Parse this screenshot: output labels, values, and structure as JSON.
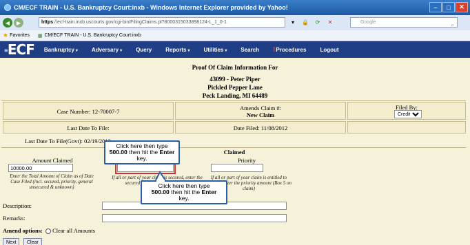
{
  "window": {
    "title": "CM/ECF TRAIN - U.S. Bankruptcy Court:inxb - Windows Internet Explorer provided by Yahoo!",
    "buttons": [
      "–",
      "□",
      "✕"
    ]
  },
  "browser": {
    "url_bold_prefix": "https",
    "url": "://ecf-train.inxb.uscourts.gov/cgi-bin/FilingClaims.pl?8000315033898124-L_1_0-1",
    "search_placeholder": "Google",
    "favorites_label": "Favorites",
    "tab_label": "CM/ECF TRAIN - U.S. Bankruptcy Court:inxb"
  },
  "ecf_menu": {
    "logo": "ECF",
    "items": [
      "Bankruptcy",
      "Adversary",
      "Query",
      "Reports",
      "Utilities",
      "Search",
      "Procedures",
      "Logout"
    ]
  },
  "header": {
    "title": "Proof Of Claim Information For",
    "case_line": "43099 - Peter Piper",
    "address1": "Pickled Pepper Lane",
    "address2": "Peck Landing, MI 64489"
  },
  "fields": {
    "case_number_label": "Case Number: 12-70007-7",
    "amends_label": "Amends Claim #:",
    "amends_value": "New Claim",
    "filed_by_label": "Filed By:",
    "filed_by_value": "Creditor",
    "last_date_label": "Last Date To File:",
    "date_filed_label": "Date Filed: 11/08/2012",
    "last_date_govt_label": "Last Date To File(Govt): 02/19/2013"
  },
  "amounts": {
    "claimed_header": "Claimed",
    "amount_claimed_label": "Amount Claimed",
    "amount_claimed_value": "10000.00",
    "amount_claimed_help": "Enter the Total Amount of Claim as of Date Case Filed (incl. secured, priority, general unsecured & unknown)",
    "secured_help": "If all or part of your claim is secured, enter the secured amount (Box 4 on claim)",
    "priority_label": "Priority",
    "priority_help": "If all or part of your claim is entitled to priority, enter the priority amount (Box 5 on claim)"
  },
  "description_label": "Description:",
  "remarks_label": "Remarks:",
  "amend_options_label": "Amend options:",
  "clear_all_label": "Clear all Amounts",
  "buttons": {
    "next": "Next",
    "clear": "Clear"
  },
  "callouts": {
    "top": {
      "line1": "Click here then type",
      "line2": "500.00",
      "line2_rest": " then hit the ",
      "line2_key": "Enter",
      "line3": "key."
    },
    "bottom": {
      "line1": "Click here then type",
      "line2": "500.00",
      "line2_rest": " then hit the ",
      "line2_key": "Enter",
      "line3": "key."
    }
  }
}
